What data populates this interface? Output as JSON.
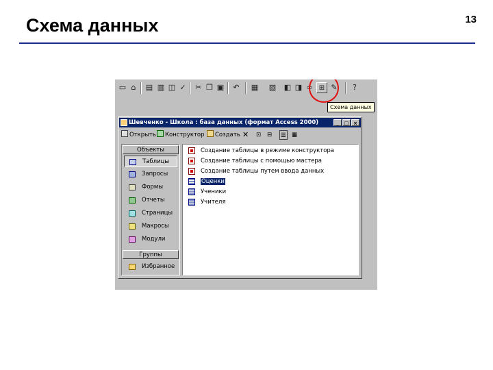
{
  "slide": {
    "title": "Схема данных",
    "page_number": "13"
  },
  "toolbar": {
    "tooltip": "Схема данных",
    "schema_button_glyph": "⊞",
    "icons": [
      "new-icon",
      "open-icon",
      "save-icon",
      "print-icon",
      "preview-icon",
      "spelling-icon",
      "cut-icon",
      "copy-icon",
      "paste-icon",
      "undo-icon",
      "analyze-icon",
      "office-links-icon",
      "code-icon",
      "properties-icon",
      "relationships-icon",
      "new-object-icon",
      "help-icon"
    ]
  },
  "db_window": {
    "title": "Шевченко - Школа : база данных (формат Access 2000)",
    "toolbar": {
      "open_label": "Открыть",
      "design_label": "Конструктор",
      "create_label": "Создать"
    },
    "groups": {
      "objects_label": "Объекты",
      "groups_label": "Группы"
    },
    "objects": [
      {
        "label": "Таблицы",
        "icon": "tables-icon"
      },
      {
        "label": "Запросы",
        "icon": "queries-icon"
      },
      {
        "label": "Формы",
        "icon": "forms-icon"
      },
      {
        "label": "Отчеты",
        "icon": "reports-icon"
      },
      {
        "label": "Страницы",
        "icon": "pages-icon"
      },
      {
        "label": "Макросы",
        "icon": "macros-icon"
      },
      {
        "label": "Модули",
        "icon": "modules-icon"
      }
    ],
    "favorites_label": "Избранное",
    "list": [
      {
        "label": "Создание таблицы в режиме конструктора",
        "icon": "wizard-icon"
      },
      {
        "label": "Создание таблицы с помощью мастера",
        "icon": "wizard-icon"
      },
      {
        "label": "Создание таблицы путем ввода данных",
        "icon": "wizard-icon"
      },
      {
        "label": "Оценки",
        "icon": "table-icon"
      },
      {
        "label": "Ученики",
        "icon": "table-icon"
      },
      {
        "label": "Учителя",
        "icon": "table-icon"
      }
    ]
  },
  "colors": {
    "title_rule": "#1a2a8c",
    "highlight": "#e01010",
    "window_title_bg": "#0a246a"
  }
}
